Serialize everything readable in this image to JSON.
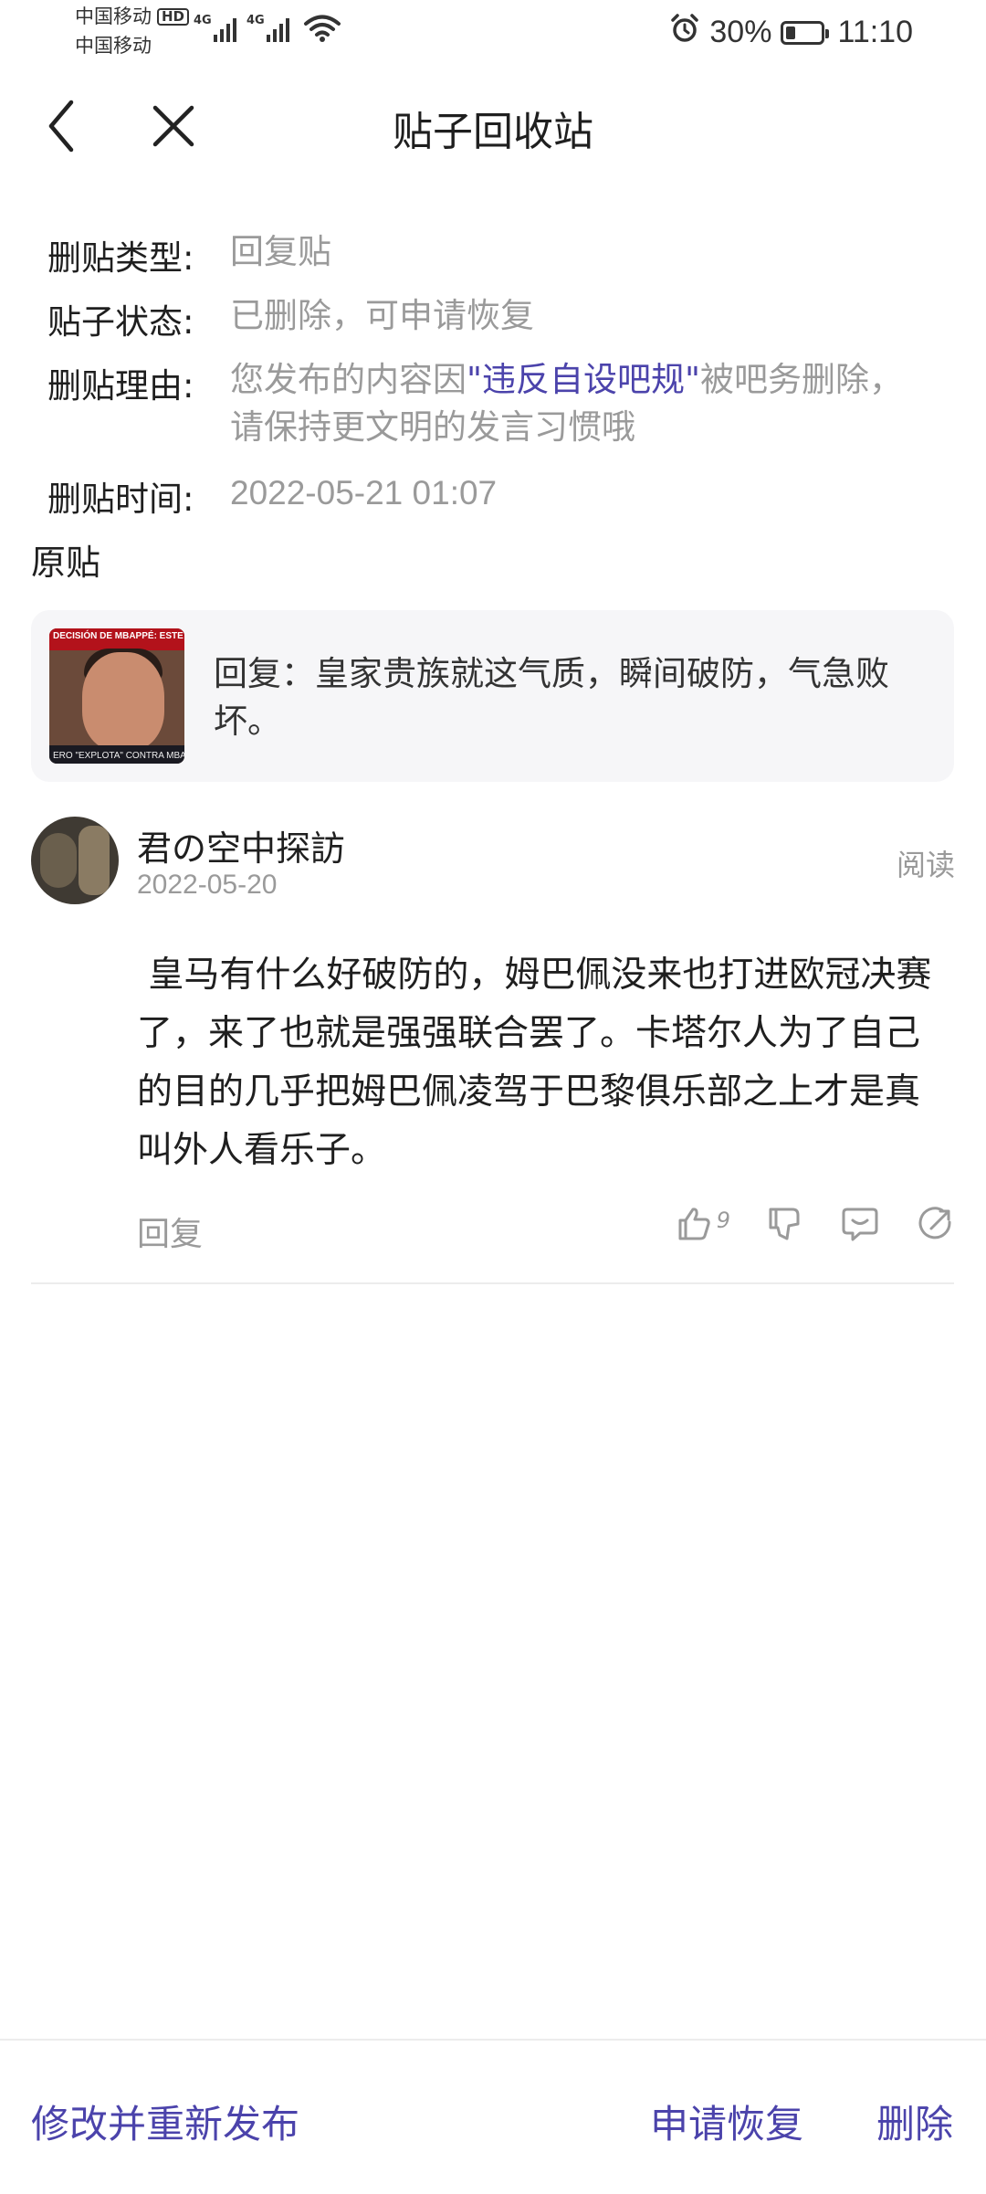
{
  "status_bar": {
    "carrier1": "中国移动",
    "carrier1_badge": "HD",
    "carrier2": "中国移动",
    "net1": "4G",
    "net2": "4G",
    "battery": "30%",
    "time": "11:10"
  },
  "nav": {
    "title": "贴子回收站"
  },
  "info": {
    "type_label": "删贴类型:",
    "type_value": "回复贴",
    "status_label": "贴子状态:",
    "status_value": "已删除，可申请恢复",
    "reason_label": "删贴理由:",
    "reason_prefix": "您发布的内容因",
    "reason_rule": "\"违反自设吧规\"",
    "reason_suffix": "被吧务删除，",
    "reason_line2": "请保持更文明的发言习惯哦",
    "time_label": "删贴时间:",
    "time_value": "2022-05-21 01:07"
  },
  "original": {
    "section_title": "原贴",
    "thumb_top_text": "DECISIÓN DE MBAPPÉ: ESTE FIN",
    "thumb_bottom_text": "ERO \"EXPLOTA\" CONTRA MBA",
    "quote_text": "回复：皇家贵族就这气质，瞬间破防，气急败坏。"
  },
  "post": {
    "username": "君の空中探訪",
    "date": "2022-05-20",
    "read_label": "阅读",
    "body": " 皇马有什么好破防的，姆巴佩没来也打进欧冠决赛了，来了也就是强强联合罢了。卡塔尔人为了自己的目的几乎把姆巴佩凌驾于巴黎俱乐部之上才是真叫外人看乐子。",
    "reply_label": "回复",
    "like_count": "9"
  },
  "bottom": {
    "edit_republish": "修改并重新发布",
    "request_restore": "申请恢复",
    "delete": "删除"
  },
  "colors": {
    "accent": "#4b43ab",
    "muted": "#9a9a9a",
    "card_bg": "#f6f6f8"
  },
  "icons": [
    "back-icon",
    "close-icon",
    "alarm-icon",
    "battery-icon",
    "wifi-icon",
    "signal-icon",
    "like-icon",
    "dislike-icon",
    "comment-icon",
    "share-icon"
  ]
}
